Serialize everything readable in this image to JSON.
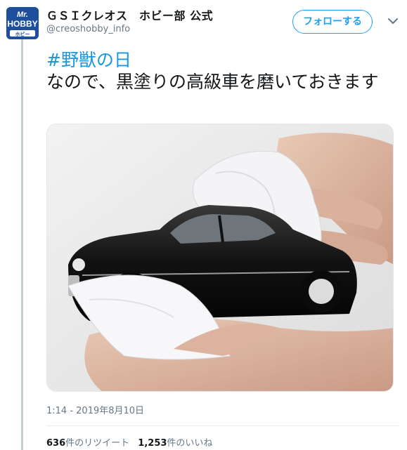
{
  "author": {
    "display_name": "ＧＳＩクレオス　ホビー部 公式",
    "handle": "@creoshobby_info",
    "avatar_text_top": "Mr.",
    "avatar_text_main": "HOBBY",
    "avatar_text_sub": "ホビー"
  },
  "follow_button": {
    "label": "フォローする"
  },
  "tweet": {
    "hashtag": "#野獣の日",
    "body": "なので、黒塗りの高級車を磨いておきます",
    "media_icon": "photo-of-black-model-car-being-polished-with-cloth"
  },
  "timestamp": "1:14 - 2019年8月10日",
  "stats": {
    "retweets_count": "636",
    "retweets_label": "件のリツイート",
    "likes_count": "1,253",
    "likes_label": "件のいいね"
  },
  "colors": {
    "accent": "#1da1f2",
    "hashtag": "#1b95e0",
    "muted": "#657786",
    "avatar_bg": "#1d4f9c"
  }
}
